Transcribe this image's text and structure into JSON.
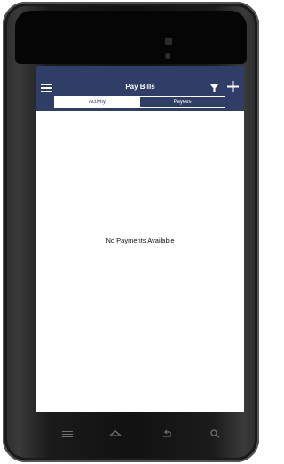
{
  "header": {
    "title": "Pay Bills",
    "menu_icon": "menu-icon",
    "filter_icon": "filter-icon",
    "add_icon": "add-icon"
  },
  "tabs": [
    {
      "label": "Activity",
      "selected": true
    },
    {
      "label": "Payees",
      "selected": false
    }
  ],
  "content": {
    "empty_message": "No Payments Available"
  },
  "device_nav": {
    "items": [
      "menu-icon",
      "home-icon",
      "back-icon",
      "search-icon"
    ]
  },
  "colors": {
    "header_bg": "#2f3e66",
    "header_text": "#ffffff",
    "body_bg": "#ffffff"
  }
}
